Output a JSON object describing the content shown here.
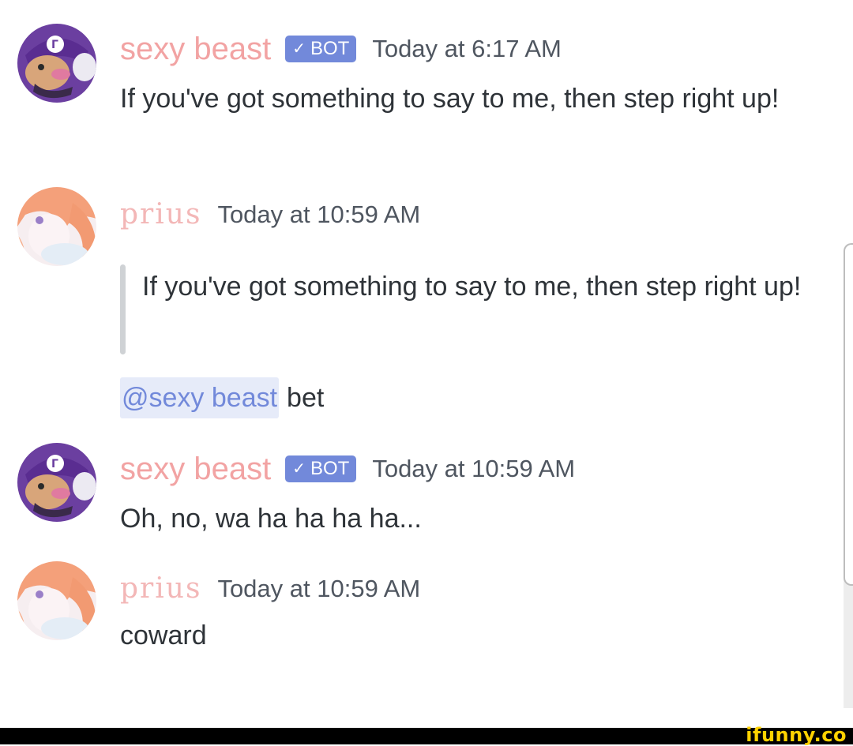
{
  "messages": [
    {
      "author": "sexy beast",
      "bot_label": "BOT",
      "bot_check": "✓",
      "timestamp": "Today at 6:17 AM",
      "text": "If you've got something to say to me, then step right up!"
    },
    {
      "author": "prius",
      "timestamp": "Today at 10:59 AM",
      "quote": "If you've got something to say to me, then step right up!",
      "mention": "@sexy beast",
      "text_after_mention": "bet"
    },
    {
      "author": "sexy beast",
      "bot_label": "BOT",
      "bot_check": "✓",
      "timestamp": "Today at 10:59 AM",
      "text": "Oh, no, wa ha ha ha ha..."
    },
    {
      "author": "prius",
      "timestamp": "Today at 10:59 AM",
      "text": "coward"
    }
  ],
  "watermark": "ifunny.co",
  "colors": {
    "username_sexy_beast": "#f2a3a3",
    "username_prius": "#f3b7b7",
    "bot_tag": "#7289da",
    "mention_bg": "#e6ebf9",
    "mention_text": "#7289da",
    "watermark": "#ffd200"
  },
  "icons": {
    "bot_avatar": "waluigi-avatar",
    "user_avatar": "anime-girl-avatar"
  }
}
